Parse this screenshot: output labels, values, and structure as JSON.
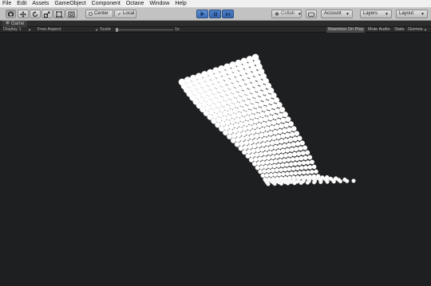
{
  "menu": [
    "File",
    "Edit",
    "Assets",
    "GameObject",
    "Component",
    "Octane",
    "Window",
    "Help"
  ],
  "toolbar": {
    "tools": [
      "hand-tool",
      "move-tool",
      "rotate-tool",
      "scale-tool",
      "rect-tool",
      "transform-tool"
    ],
    "pivot_label": "Center",
    "space_label": "Local",
    "collab_label": "Collab",
    "account_label": "Account",
    "layers_label": "Layers",
    "layout_label": "Layout",
    "play_state": "playing"
  },
  "tab": {
    "title": "Game"
  },
  "game_bar": {
    "display_label": "Display 1",
    "aspect_label": "Free Aspect",
    "scale_label": "Scale",
    "scale_value": "1x",
    "scale_fraction": 0.0,
    "maximize_label": "Maximize On Play",
    "maximize_on": true,
    "mute_label": "Mute Audio",
    "stats_label": "Stats",
    "gizmos_label": "Gizmos"
  },
  "scene": {
    "background": "#1e1f21",
    "sphere_color": "#ffffff",
    "grid_rows": 30,
    "grid_cols": 14
  }
}
